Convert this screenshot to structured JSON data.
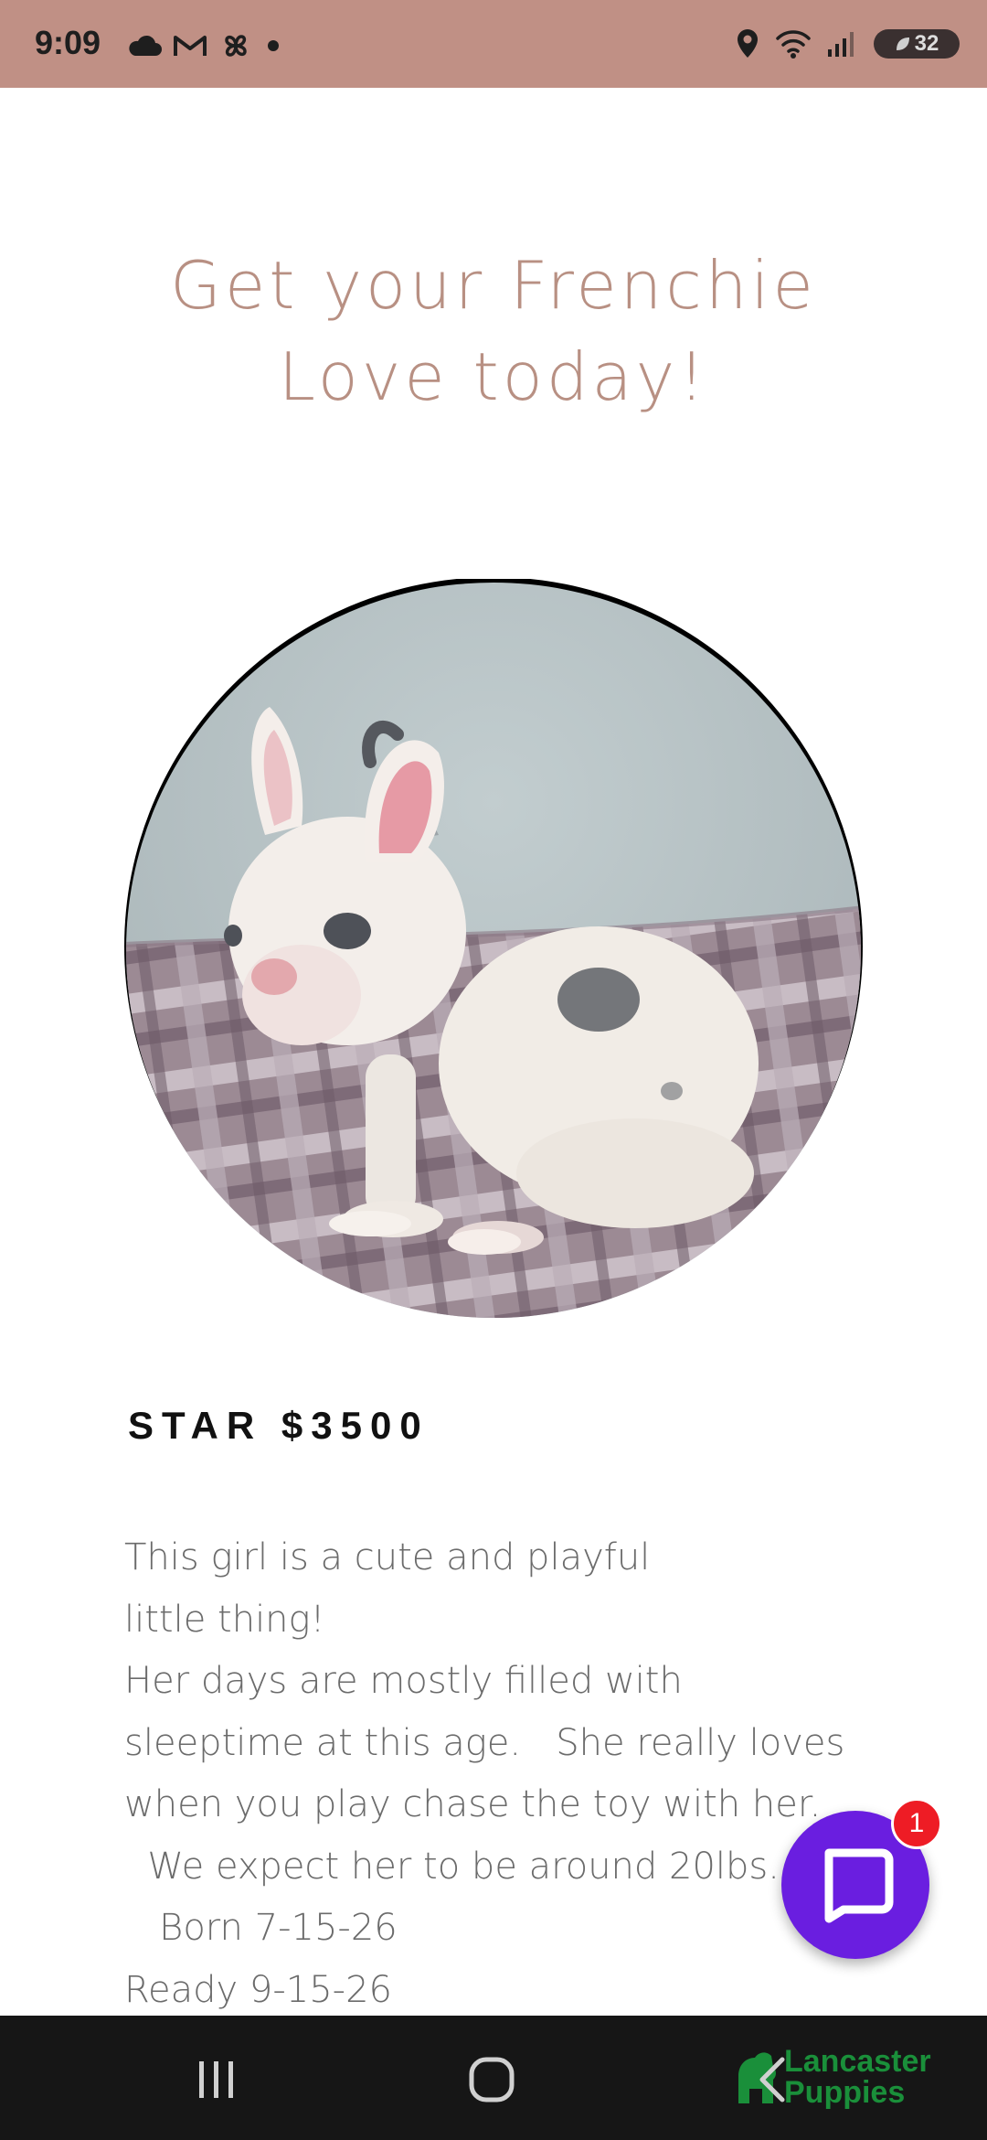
{
  "status_bar": {
    "time": "9:09",
    "battery": "32",
    "icons": [
      "cloud-icon",
      "gmail-icon",
      "pinwheel-icon",
      "dot-icon",
      "location-icon",
      "wifi-icon",
      "signal-icon",
      "battery-icon"
    ]
  },
  "headline": {
    "line1": "Get your Frenchie",
    "line2": "Love today!"
  },
  "puppy": {
    "image_alt": "French bulldog puppy sitting on a plaid blanket",
    "name_price": "STAR $3500",
    "description_lines": [
      "This girl is a cute and playful",
      "little thing!",
      "Her days are mostly filled with",
      "sleeptime at this age.   She really loves",
      "when you play chase the toy with her.",
      "  We expect her to be around 20lbs.",
      "   Born 7-15-26",
      "Ready 9-15-26"
    ]
  },
  "chat": {
    "badge_count": "1"
  },
  "nav_bar": {
    "watermark_line1": "Lancaster",
    "watermark_line2": "Puppies"
  },
  "colors": {
    "status_bar_bg": "#c09085",
    "headline": "#b89083",
    "chat_button": "#6a1ee0",
    "badge": "#ee1c25",
    "watermark": "#1a8f3a"
  }
}
